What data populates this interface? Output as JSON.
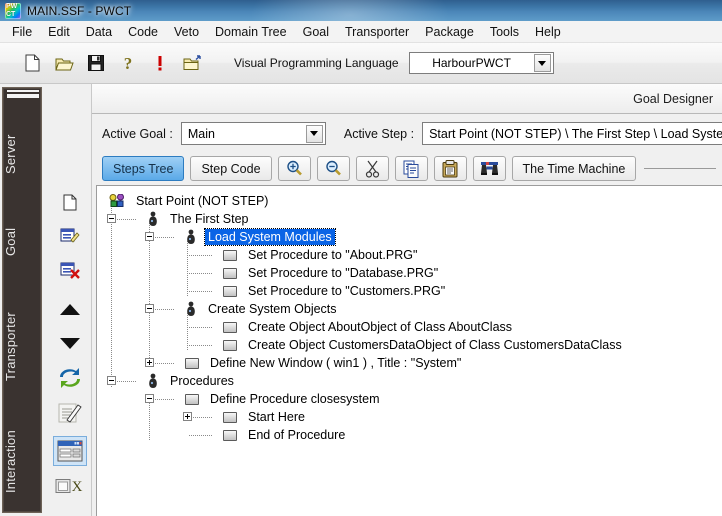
{
  "window": {
    "title": "MAIN.SSF  - PWCT",
    "app_icon": "pwct-rainbow-icon"
  },
  "menubar": {
    "items": [
      {
        "label": "File"
      },
      {
        "label": "Edit"
      },
      {
        "label": "Data"
      },
      {
        "label": "Code"
      },
      {
        "label": "Veto"
      },
      {
        "label": "Domain Tree"
      },
      {
        "label": "Goal"
      },
      {
        "label": "Transporter"
      },
      {
        "label": "Package"
      },
      {
        "label": "Tools"
      },
      {
        "label": "Help"
      }
    ]
  },
  "toolbar": {
    "buttons": [
      {
        "icon": "new-file-icon",
        "name": "new-file-button"
      },
      {
        "icon": "open-folder-icon",
        "name": "open-file-button"
      },
      {
        "icon": "save-floppy-icon",
        "name": "save-button"
      },
      {
        "icon": "question-mark-icon",
        "name": "help-button"
      },
      {
        "icon": "exclamation-mark-icon",
        "name": "about-button"
      },
      {
        "icon": "open-folder-arrow-icon",
        "name": "open-recent-button"
      }
    ],
    "language_label": "Visual Programming Language",
    "language_value": "HarbourPWCT"
  },
  "sidebar": {
    "tabs": [
      {
        "label": "Server"
      },
      {
        "label": "Goal"
      },
      {
        "label": "Transporter"
      },
      {
        "label": "Interaction"
      }
    ]
  },
  "icon_rail": {
    "items": [
      {
        "name": "new-document-icon",
        "icon": "new-document"
      },
      {
        "name": "edit-form-icon",
        "icon": "form-edit"
      },
      {
        "name": "delete-form-icon",
        "icon": "form-delete"
      },
      {
        "name": "move-up-icon",
        "icon": "triangle-up"
      },
      {
        "name": "move-down-icon",
        "icon": "triangle-down"
      },
      {
        "name": "refresh-icon",
        "icon": "sync-arrows"
      },
      {
        "name": "notes-icon",
        "icon": "notepad-pencil"
      },
      {
        "name": "window-designer-icon",
        "icon": "form-window"
      },
      {
        "name": "close-icon",
        "icon": "checkbox-x"
      }
    ]
  },
  "designer": {
    "title": "Goal Designer",
    "active_goal_label": "Active Goal :",
    "active_goal_value": "Main",
    "active_step_label": "Active Step :",
    "active_step_value": "Start Point (NOT STEP) \\ The First Step \\ Load System Modules"
  },
  "actionbar": {
    "buttons": [
      {
        "label": "Steps Tree",
        "name": "tab-steps-tree",
        "active": true,
        "kind": "text"
      },
      {
        "label": "Step Code",
        "name": "tab-step-code",
        "active": false,
        "kind": "text"
      },
      {
        "label": "",
        "name": "zoom-in-button",
        "active": false,
        "kind": "icon",
        "icon": "zoom-in-icon"
      },
      {
        "label": "",
        "name": "zoom-out-button",
        "active": false,
        "kind": "icon",
        "icon": "zoom-out-icon"
      },
      {
        "label": "",
        "name": "cut-button",
        "active": false,
        "kind": "icon",
        "icon": "scissors-icon"
      },
      {
        "label": "",
        "name": "copy-button",
        "active": false,
        "kind": "icon",
        "icon": "copy-icon"
      },
      {
        "label": "",
        "name": "paste-button",
        "active": false,
        "kind": "icon",
        "icon": "clipboard-icon"
      },
      {
        "label": "",
        "name": "find-button",
        "active": false,
        "kind": "icon",
        "icon": "binoculars-icon"
      },
      {
        "label": "The Time Machine",
        "name": "time-machine-button",
        "active": false,
        "kind": "text"
      }
    ]
  },
  "tree": {
    "nodes": [
      {
        "label": "Start Point (NOT STEP)",
        "depth": 0,
        "icon": "start-point-icon",
        "toggle": "none",
        "selected": false
      },
      {
        "label": "The First Step",
        "depth": 1,
        "icon": "step-icon",
        "toggle": "minus",
        "selected": false
      },
      {
        "label": "Load System Modules",
        "depth": 2,
        "icon": "step-icon",
        "toggle": "minus",
        "selected": true
      },
      {
        "label": "Set Procedure to \"About.PRG\"",
        "depth": 3,
        "icon": "component-icon",
        "toggle": "none",
        "selected": false
      },
      {
        "label": "Set Procedure to \"Database.PRG\"",
        "depth": 3,
        "icon": "component-icon",
        "toggle": "none",
        "selected": false
      },
      {
        "label": "Set Procedure to \"Customers.PRG\"",
        "depth": 3,
        "icon": "component-icon",
        "toggle": "none",
        "selected": false
      },
      {
        "label": "Create System Objects",
        "depth": 2,
        "icon": "step-icon",
        "toggle": "minus",
        "selected": false
      },
      {
        "label": "Create Object AboutObject of Class AboutClass",
        "depth": 3,
        "icon": "component-icon",
        "toggle": "none",
        "selected": false
      },
      {
        "label": "Create Object CustomersDataObject of Class CustomersDataClass",
        "depth": 3,
        "icon": "component-icon",
        "toggle": "none",
        "selected": false
      },
      {
        "label": "Define New Window  ( win1 ) , Title : \"System\"",
        "depth": 2,
        "icon": "component-icon",
        "toggle": "plus",
        "selected": false
      },
      {
        "label": "Procedures",
        "depth": 1,
        "icon": "step-icon",
        "toggle": "minus",
        "selected": false
      },
      {
        "label": "Define Procedure closesystem",
        "depth": 2,
        "icon": "component-icon",
        "toggle": "minus",
        "selected": false
      },
      {
        "label": "Start Here",
        "depth": 3,
        "icon": "component-icon",
        "toggle": "plus",
        "selected": false
      },
      {
        "label": "End of Procedure",
        "depth": 3,
        "icon": "component-icon",
        "toggle": "none",
        "selected": false
      }
    ]
  },
  "colors": {
    "selection": "#0a64e6",
    "titlebar": "#3e78a9",
    "sidebar": "#3a3330",
    "accent_tab": "#5aa9e8"
  }
}
